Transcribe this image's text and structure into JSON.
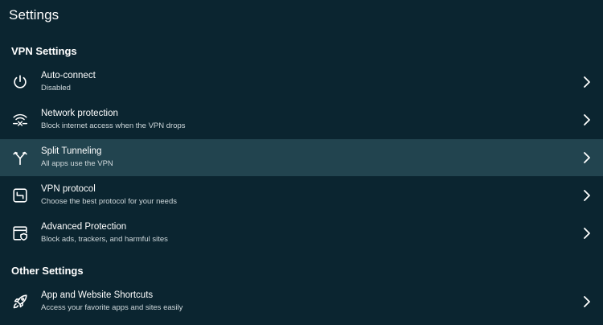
{
  "page": {
    "title": "Settings"
  },
  "vpn_section": {
    "header": "VPN Settings",
    "items": [
      {
        "title": "Auto-connect",
        "subtitle": "Disabled",
        "icon": "power-icon"
      },
      {
        "title": "Network protection",
        "subtitle": "Block internet access when the VPN drops",
        "icon": "network-protection-icon"
      },
      {
        "title": "Split Tunneling",
        "subtitle": "All apps use the VPN",
        "icon": "split-tunneling-icon",
        "selected": true
      },
      {
        "title": "VPN protocol",
        "subtitle": "Choose the best protocol for your needs",
        "icon": "vpn-protocol-icon"
      },
      {
        "title": "Advanced Protection",
        "subtitle": "Block ads, trackers, and harmful sites",
        "icon": "advanced-protection-icon"
      }
    ]
  },
  "other_section": {
    "header": "Other Settings",
    "items": [
      {
        "title": "App and Website Shortcuts",
        "subtitle": "Access your favorite apps and sites easily",
        "icon": "rocket-icon"
      }
    ]
  },
  "colors": {
    "background": "#0b2530",
    "selected_row": "#22444f",
    "text_primary": "#ffffff",
    "text_secondary": "#cfd8db"
  }
}
